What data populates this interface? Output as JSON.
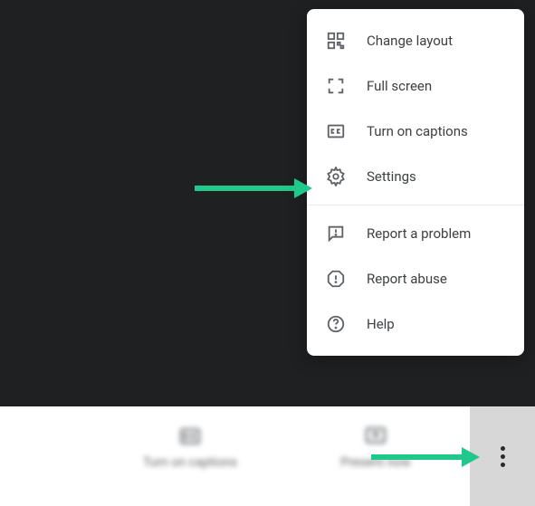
{
  "menu": {
    "items": [
      {
        "label": "Change layout"
      },
      {
        "label": "Full screen"
      },
      {
        "label": "Turn on captions"
      },
      {
        "label": "Settings"
      },
      {
        "label": "Report a problem"
      },
      {
        "label": "Report abuse"
      },
      {
        "label": "Help"
      }
    ]
  },
  "toolbar": {
    "captions_label": "Turn on captions",
    "present_label": "Present now"
  }
}
